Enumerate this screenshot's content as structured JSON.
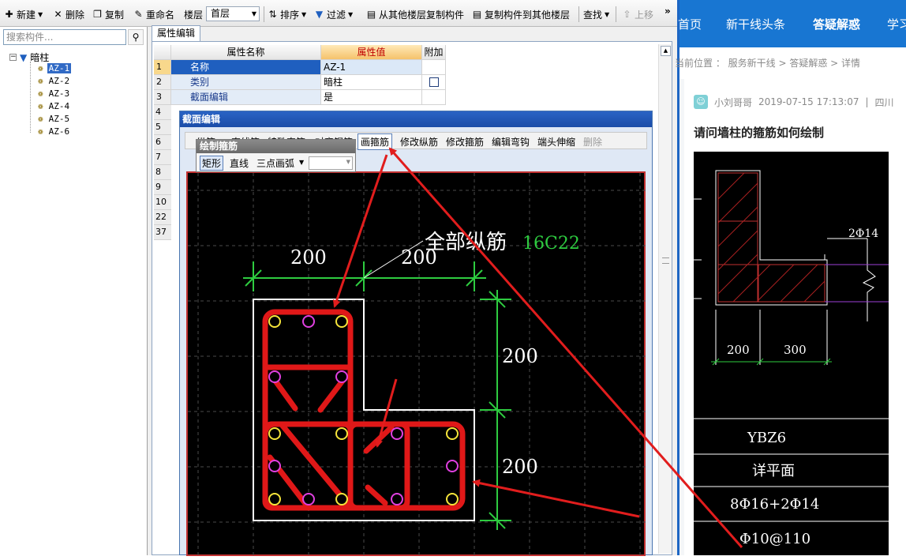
{
  "toolbar": {
    "new": "新建",
    "delete": "删除",
    "copy": "复制",
    "rename": "重命名",
    "floor_label": "楼层",
    "floor_value": "首层",
    "sort": "排序",
    "filter": "过滤",
    "copy_from_floor": "从其他楼层复制构件",
    "copy_to_floor": "复制构件到其他楼层",
    "find": "查找",
    "move_up": "上移",
    "more": "»"
  },
  "left_panel": {
    "search_placeholder": "搜索构件...",
    "root_label": "暗柱",
    "items": [
      "AZ-1",
      "AZ-2",
      "AZ-3",
      "AZ-4",
      "AZ-5",
      "AZ-6"
    ]
  },
  "prop_grid": {
    "tab": "属性编辑",
    "headers": [
      "属性名称",
      "属性值",
      "附加"
    ],
    "rows": [
      {
        "num": "1",
        "name": "名称",
        "value": "AZ-1"
      },
      {
        "num": "2",
        "name": "类别",
        "value": "暗柱"
      },
      {
        "num": "3",
        "name": "截面编辑",
        "value": "是"
      }
    ],
    "more_rows": [
      "4",
      "5",
      "6",
      "7",
      "8",
      "9",
      "10",
      "22",
      "37"
    ]
  },
  "section_editor": {
    "title": "截面编辑",
    "buttons": [
      "纵筋",
      "直线筋",
      "特殊直筋",
      "对齐钢筋",
      "画箍筋",
      "修改纵筋",
      "修改箍筋",
      "编辑弯钩",
      "端头伸缩",
      "删除"
    ],
    "pressed_button": "画箍筋"
  },
  "sub_toolbar": {
    "title": "绘制箍筋",
    "rect": "矩形",
    "line": "直线",
    "arc": "三点画弧"
  },
  "drawing": {
    "label": "全部纵筋",
    "rebar": "16C22",
    "dim_top_left": "200",
    "dim_top_right": "200",
    "dim_right_top": "200",
    "dim_right_bottom": "200"
  },
  "web": {
    "nav": [
      "首页",
      "新干线头条",
      "答疑解惑",
      "学习"
    ],
    "nav_active": "答疑解惑",
    "breadcrumb": "当前位置 ： 服务新干线 > 答疑解惑 > 详情",
    "author": "小刘哥哥",
    "date": "2019-07-15 17:13:07",
    "divider": "|",
    "region": "四川",
    "question_title": "请问墙柱的箍筋如何绘制",
    "cad": {
      "rebar_label": "2Φ14",
      "dim_left": "200",
      "dim_right": "300",
      "name": "YBZ6",
      "section": "详平面",
      "main_rebar": "8Φ16+2Φ14",
      "stirrup": "Φ10@110"
    }
  },
  "colors": {
    "accent_blue": "#1876d2",
    "annotation_red": "#e11d1d",
    "dimension_green": "#2ecc40"
  }
}
